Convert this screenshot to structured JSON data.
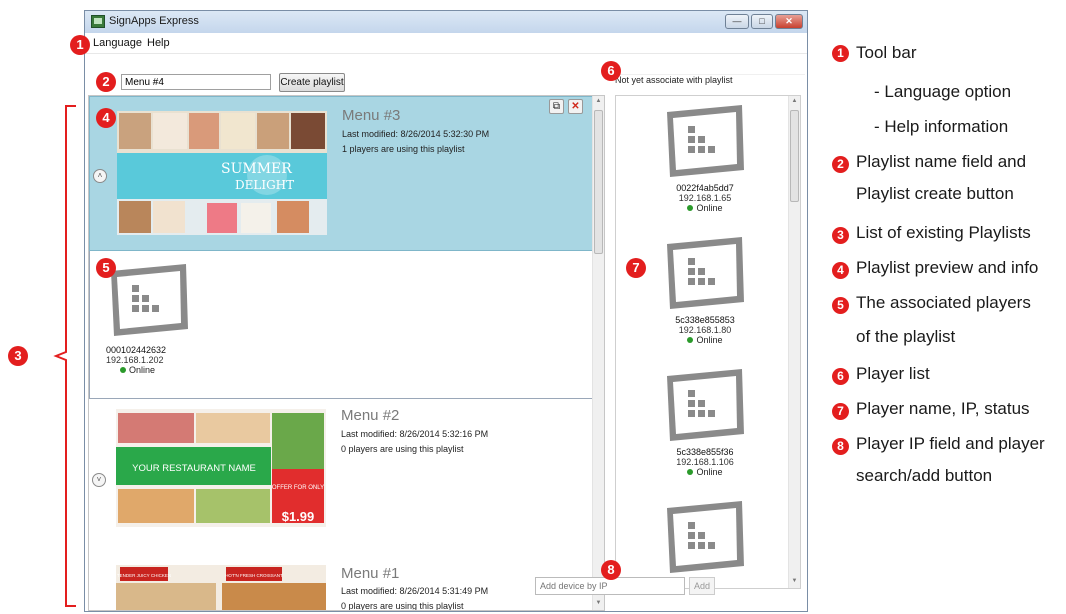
{
  "window": {
    "title": "SignApps Express"
  },
  "menu": {
    "items": [
      "Language",
      "Help"
    ]
  },
  "playlist_form": {
    "name_value": "Menu #4",
    "create_label": "Create playlist"
  },
  "playlists": [
    {
      "title": "Menu #3",
      "modified": "Last modified: 8/26/2014 5:32:30 PM",
      "players": "1 players are using this playlist",
      "thumb_headline": "SUMMER",
      "thumb_sub": "DELIGHT"
    },
    {
      "title": "Menu #2",
      "modified": "Last modified: 8/26/2014 5:32:16 PM",
      "players": "0 players are using this playlist",
      "thumb_headline": "YOUR RESTAURANT NAME",
      "thumb_price": "$1.99",
      "thumb_offer": "OFFER FOR ONLY"
    },
    {
      "title": "Menu #1",
      "modified": "Last modified: 8/26/2014 5:31:49 PM",
      "players": "0 players are using this playlist",
      "thumb_tag1": "TENDER JUICY CHICKEN",
      "thumb_tag2": "HOT'N FRESH CROISSANT"
    }
  ],
  "associated_player": {
    "name": "000102442632",
    "ip": "192.168.1.202",
    "status": "Online"
  },
  "player_list": {
    "header": "Not yet associate with playlist",
    "players": [
      {
        "name": "0022f4ab5dd7",
        "ip": "192.168.1.65",
        "status": "Online"
      },
      {
        "name": "5c338e855853",
        "ip": "192.168.1.80",
        "status": "Online"
      },
      {
        "name": "5c338e855f36",
        "ip": "192.168.1.106",
        "status": "Online"
      }
    ],
    "add_placeholder": "Add device by IP",
    "add_label": "Add"
  },
  "badges": [
    "1",
    "2",
    "3",
    "4",
    "5",
    "6",
    "7",
    "8"
  ],
  "legend": {
    "item1": "Tool bar",
    "item1a": "- Language option",
    "item1b": "- Help information",
    "item2a": "Playlist name field and",
    "item2b": "Playlist create button",
    "item3": "List of existing Playlists",
    "item4": "Playlist preview and info",
    "item5a": "The associated players",
    "item5b": "of the playlist",
    "item6": "Player list",
    "item7": "Player name, IP, status",
    "item8a": "Player IP field and player",
    "item8b": "search/add button"
  },
  "colors": {
    "badge": "#e31e1e",
    "selected_card": "#a9d6e3",
    "online": "#2b9a2b"
  },
  "icons": [
    "monitor-icon",
    "copy-icon",
    "delete-icon",
    "chevron-up-icon",
    "chevron-down-icon"
  ]
}
